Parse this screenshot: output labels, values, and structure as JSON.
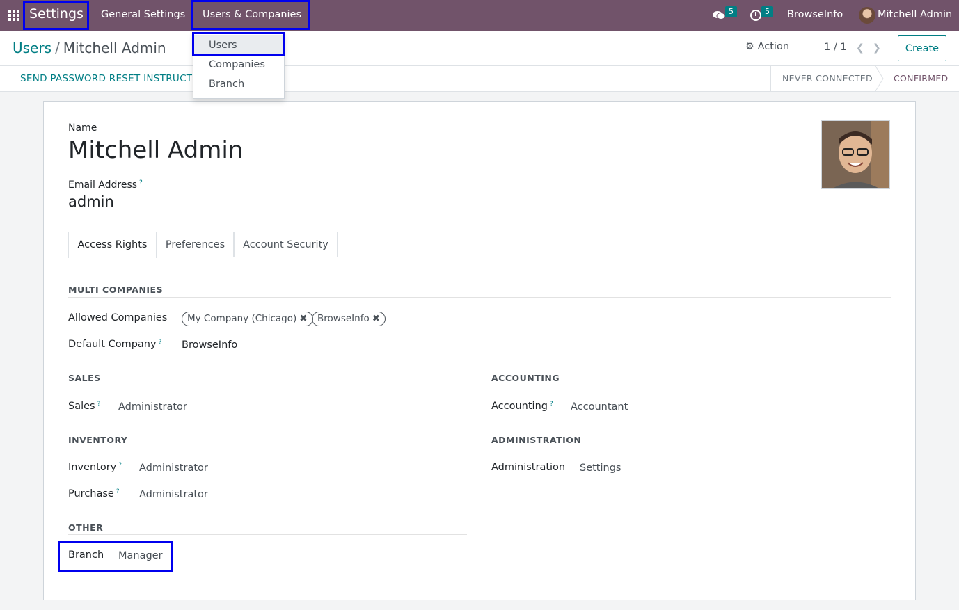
{
  "navbar": {
    "brand": "Settings",
    "menu": [
      "General Settings",
      "Users & Companies"
    ],
    "messages_count": "5",
    "activities_count": "5",
    "company": "BrowseInfo",
    "user": "Mitchell Admin"
  },
  "dropdown": {
    "items": [
      "Users",
      "Companies",
      "Branch"
    ]
  },
  "control": {
    "breadcrumb_parent": "Users",
    "breadcrumb_sep": "/",
    "breadcrumb_current": "Mitchell Admin",
    "action_label": "Action",
    "pager": "1 / 1",
    "create_label": "Create"
  },
  "statusbar": {
    "reset_label": "SEND PASSWORD RESET INSTRUCT",
    "stages": [
      "NEVER CONNECTED",
      "CONFIRMED"
    ]
  },
  "form": {
    "name_label": "Name",
    "name_value": "Mitchell Admin",
    "email_label": "Email Address",
    "email_value": "admin",
    "help_mark": "?",
    "tabs": [
      "Access Rights",
      "Preferences",
      "Account Security"
    ],
    "groups": {
      "multi_companies": {
        "title": "MULTI COMPANIES",
        "allowed_label": "Allowed Companies",
        "allowed_tags": [
          "My Company (Chicago)",
          "BrowseInfo"
        ],
        "default_label": "Default Company",
        "default_value": "BrowseInfo"
      },
      "sales": {
        "title": "SALES",
        "label": "Sales",
        "value": "Administrator"
      },
      "accounting": {
        "title": "ACCOUNTING",
        "label": "Accounting",
        "value": "Accountant"
      },
      "inventory": {
        "title": "INVENTORY",
        "inventory_label": "Inventory",
        "inventory_value": "Administrator",
        "purchase_label": "Purchase",
        "purchase_value": "Administrator"
      },
      "administration": {
        "title": "ADMINISTRATION",
        "label": "Administration",
        "value": "Settings"
      },
      "other": {
        "title": "OTHER",
        "label": "Branch",
        "value": "Manager"
      }
    }
  },
  "colors": {
    "navbar": "#71536a",
    "accent": "#017e84",
    "highlight": "#0000ee"
  }
}
